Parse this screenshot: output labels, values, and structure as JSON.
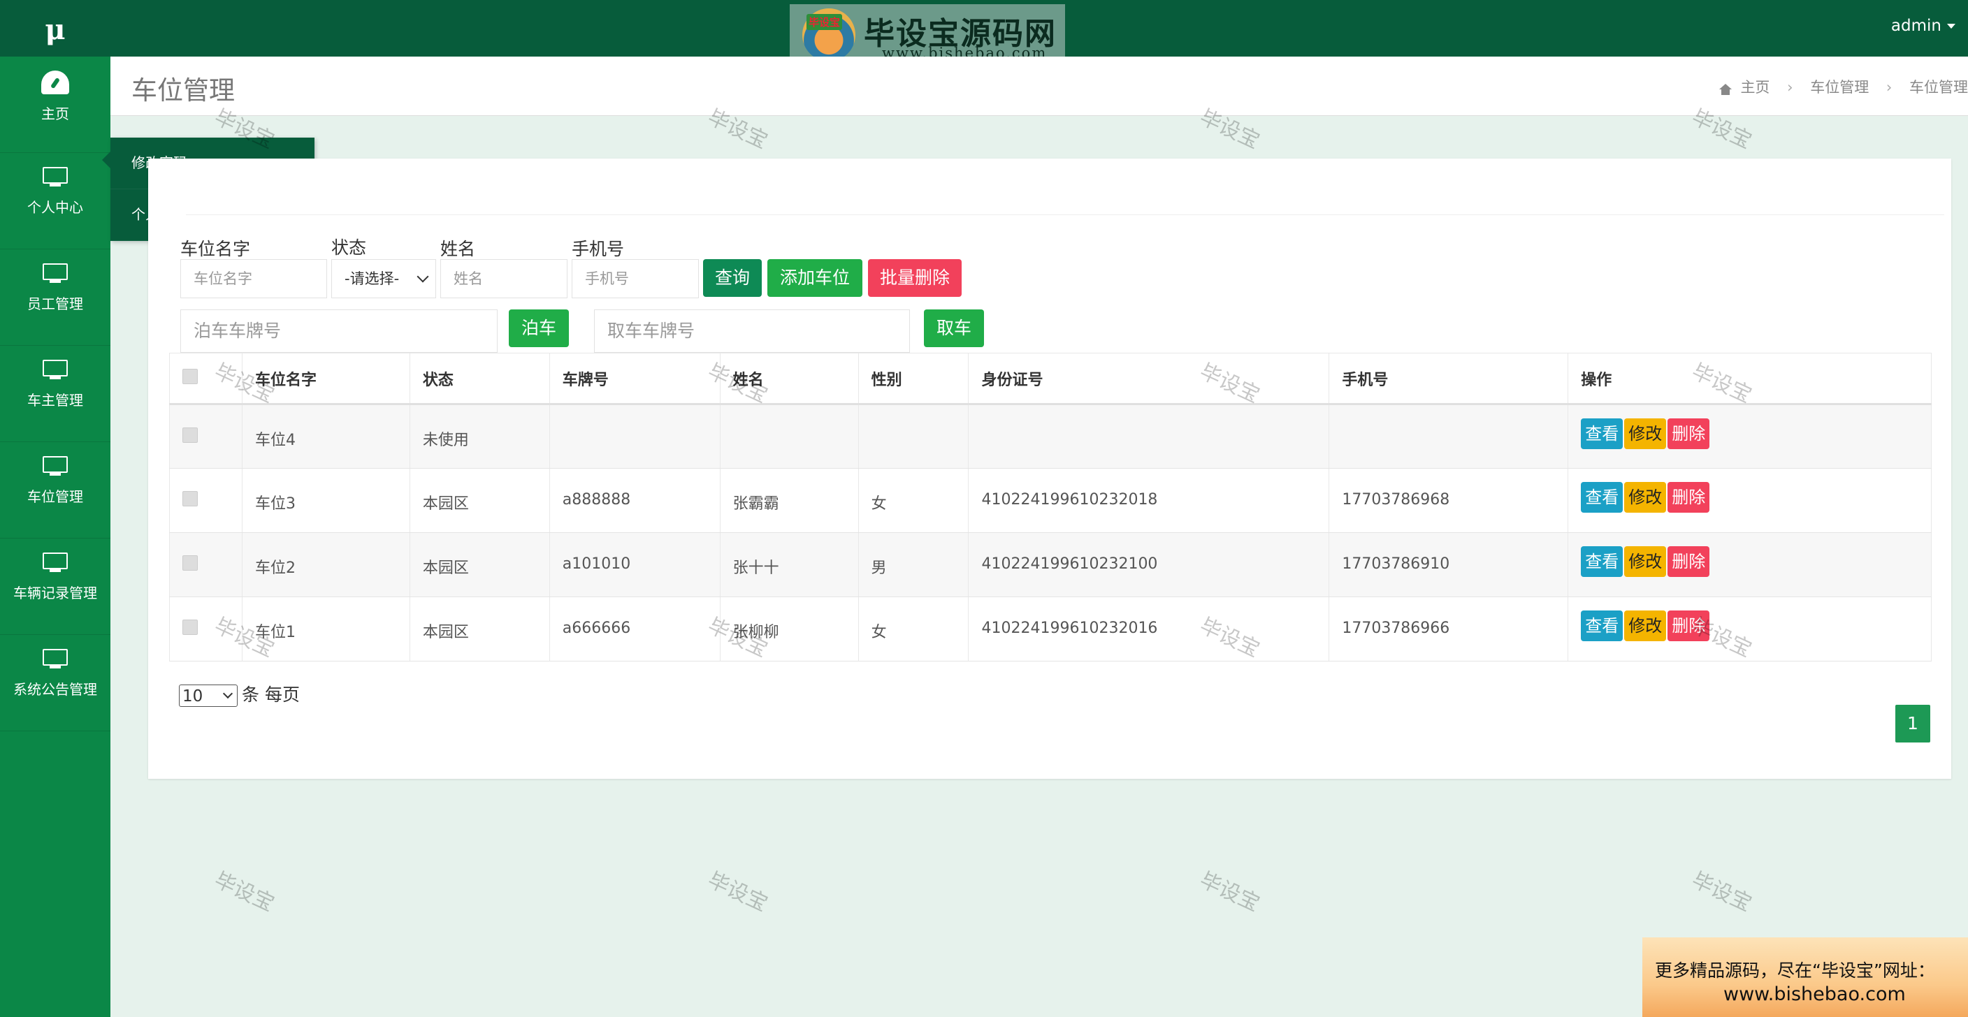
{
  "sidebar": {
    "brand": "μ",
    "items": [
      {
        "label": "主页",
        "icon": "dashboard-icon"
      },
      {
        "label": "个人中心",
        "icon": "monitor-icon"
      },
      {
        "label": "员工管理",
        "icon": "monitor-icon"
      },
      {
        "label": "车主管理",
        "icon": "monitor-icon"
      },
      {
        "label": "车位管理",
        "icon": "monitor-icon"
      },
      {
        "label": "车辆记录管理",
        "icon": "monitor-icon"
      },
      {
        "label": "系统公告管理",
        "icon": "monitor-icon"
      }
    ],
    "submenu": [
      "修改密码",
      "个人信息"
    ]
  },
  "topbar": {
    "user": "admin",
    "logo_badge": "毕设宝",
    "logo_text": "毕设宝源码网",
    "logo_url": "www.bishebao.com"
  },
  "page": {
    "title": "车位管理",
    "breadcrumb": [
      "主页",
      "车位管理",
      "车位管理"
    ]
  },
  "filters": {
    "space_name": {
      "label": "车位名字",
      "placeholder": "车位名字"
    },
    "status": {
      "label": "状态",
      "value": "-请选择-"
    },
    "name": {
      "label": "姓名",
      "placeholder": "姓名"
    },
    "phone": {
      "label": "手机号",
      "placeholder": "手机号"
    },
    "query_btn": "查询",
    "add_btn": "添加车位",
    "batch_delete_btn": "批量删除",
    "park_placeholder": "泊车车牌号",
    "park_btn": "泊车",
    "pickup_placeholder": "取车车牌号",
    "pickup_btn": "取车"
  },
  "table": {
    "headers": [
      "车位名字",
      "状态",
      "车牌号",
      "姓名",
      "性别",
      "身份证号",
      "手机号",
      "操作"
    ],
    "rows": [
      {
        "space": "车位4",
        "status": "未使用",
        "plate": "",
        "name": "",
        "gender": "",
        "id_no": "",
        "phone": ""
      },
      {
        "space": "车位3",
        "status": "本园区",
        "plate": "a888888",
        "name": "张霸霸",
        "gender": "女",
        "id_no": "410224199610232018",
        "phone": "17703786968"
      },
      {
        "space": "车位2",
        "status": "本园区",
        "plate": "a101010",
        "name": "张十十",
        "gender": "男",
        "id_no": "410224199610232100",
        "phone": "17703786910"
      },
      {
        "space": "车位1",
        "status": "本园区",
        "plate": "a666666",
        "name": "张柳柳",
        "gender": "女",
        "id_no": "410224199610232016",
        "phone": "17703786966"
      }
    ],
    "actions": {
      "view": "查看",
      "edit": "修改",
      "delete": "删除"
    }
  },
  "pagination": {
    "per_page": "10",
    "per_page_suffix": "条 每页",
    "current_page": "1"
  },
  "watermark": "毕设宝",
  "promo": {
    "line1": "更多精品源码，尽在“毕设宝”网址：",
    "line2": "www.bishebao.com"
  }
}
